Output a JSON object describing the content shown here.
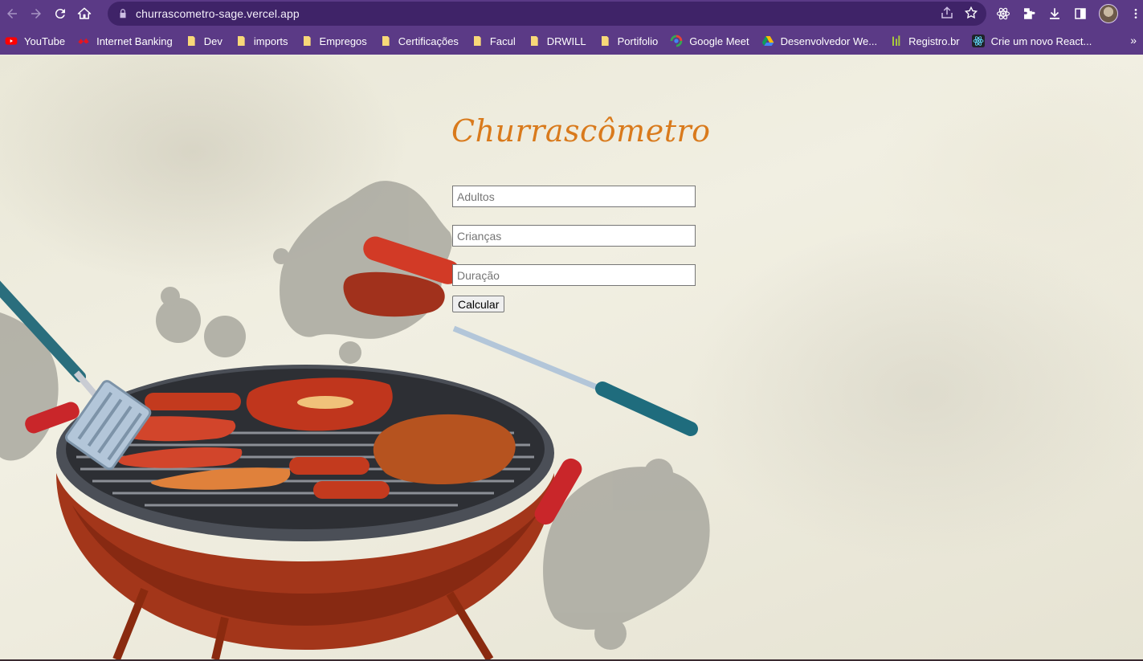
{
  "browser": {
    "url": "churrascometro-sage.vercel.app",
    "bookmarks": [
      {
        "label": "YouTube",
        "icon": "youtube-icon"
      },
      {
        "label": "Internet Banking",
        "icon": "bank-icon"
      },
      {
        "label": "Dev",
        "icon": "folder-icon"
      },
      {
        "label": "imports",
        "icon": "folder-icon"
      },
      {
        "label": "Empregos",
        "icon": "folder-icon"
      },
      {
        "label": "Certificações",
        "icon": "folder-icon"
      },
      {
        "label": "Facul",
        "icon": "folder-icon"
      },
      {
        "label": "DRWILL",
        "icon": "folder-icon"
      },
      {
        "label": "Portifolio",
        "icon": "folder-icon"
      },
      {
        "label": "Google Meet",
        "icon": "google-meet-icon"
      },
      {
        "label": "Desenvolvedor We...",
        "icon": "google-drive-icon"
      },
      {
        "label": "Registro.br",
        "icon": "registro-icon"
      },
      {
        "label": "Crie um novo React...",
        "icon": "react-icon"
      }
    ],
    "more_label": "»"
  },
  "app": {
    "title": "Churrascômetro",
    "fields": {
      "adults_placeholder": "Adultos",
      "children_placeholder": "Crianças",
      "duration_placeholder": "Duração"
    },
    "calculate_label": "Calcular"
  },
  "colors": {
    "browser_chrome": "#5b3a86",
    "omnibox": "#3f2368",
    "title": "#d97a1c"
  }
}
